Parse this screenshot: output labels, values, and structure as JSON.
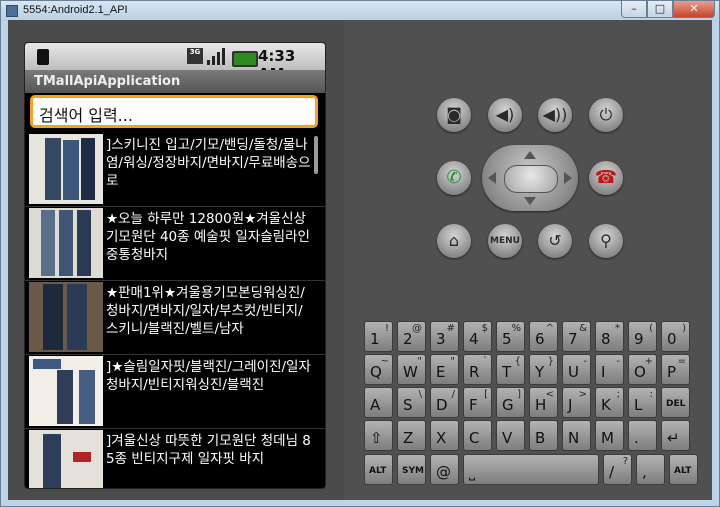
{
  "window": {
    "title": "5554:Android2.1_API",
    "minimize": "–",
    "maximize": "□",
    "close": "✕"
  },
  "statusbar": {
    "time": "4:33 AM",
    "network": "3G"
  },
  "app": {
    "title": "TMallApiApplication",
    "search_placeholder": "검색어 입력..."
  },
  "list": {
    "items": [
      {
        "text": "]스키니진 입고/기모/밴딩/돌청/물나염/워싱/정장바지/면바지/무료배송으로"
      },
      {
        "text": "★오늘 하루만 12800원★겨울신상 기모원단 40종 예술핏 일자슬림라인 중통청바지"
      },
      {
        "text": "★판매1위★겨울용기모본딩워싱진/청바지/면바지/일자/부츠컷/빈티지/스키니/블랙진/벨트/남자"
      },
      {
        "text": "]★슬림일자핏/블랙진/그레이진/일자청바지/빈티지워싱진/블랙진"
      },
      {
        "text": "]겨울신상 따뜻한 기모원단 청데님 85종 빈티지구제 일자핏 바지"
      }
    ]
  },
  "controls": {
    "camera": "camera-icon",
    "vol_down": "volume-down-icon",
    "vol_up": "volume-up-icon",
    "power": "power-icon",
    "call": "call-icon",
    "end_call": "end-call-icon",
    "home": "home-icon",
    "menu": "MENU",
    "back": "back-icon",
    "search": "search-icon"
  },
  "keyboard": {
    "row1": [
      [
        "1",
        "!"
      ],
      [
        "2",
        "@"
      ],
      [
        "3",
        "#"
      ],
      [
        "4",
        "$"
      ],
      [
        "5",
        "%"
      ],
      [
        "6",
        "^"
      ],
      [
        "7",
        "&"
      ],
      [
        "8",
        "*"
      ],
      [
        "9",
        "("
      ],
      [
        "0",
        ")"
      ]
    ],
    "row2": [
      [
        "Q",
        "~"
      ],
      [
        "W",
        "\""
      ],
      [
        "E",
        "\""
      ],
      [
        "R",
        "`"
      ],
      [
        "T",
        "{"
      ],
      [
        "Y",
        "}"
      ],
      [
        "U",
        "-"
      ],
      [
        "I",
        "-"
      ],
      [
        "O",
        "+"
      ],
      [
        "P",
        "="
      ]
    ],
    "row3": [
      [
        "A",
        ""
      ],
      [
        "S",
        "\\"
      ],
      [
        "D",
        "/"
      ],
      [
        "F",
        "["
      ],
      [
        "G",
        "]"
      ],
      [
        "H",
        "<"
      ],
      [
        "J",
        ">"
      ],
      [
        "K",
        ";"
      ],
      [
        "L",
        ":"
      ],
      [
        "DEL",
        ""
      ]
    ],
    "row4": [
      [
        "⇧",
        ""
      ],
      [
        "Z",
        ""
      ],
      [
        "X",
        ""
      ],
      [
        "C",
        ""
      ],
      [
        "V",
        ""
      ],
      [
        "B",
        ""
      ],
      [
        "N",
        ""
      ],
      [
        "M",
        ""
      ],
      [
        ".",
        ""
      ],
      [
        "↵",
        ""
      ]
    ],
    "row5": [
      [
        "ALT",
        ""
      ],
      [
        "SYM",
        ""
      ],
      [
        "@",
        ""
      ],
      [
        "⎵",
        ""
      ],
      [
        "/",
        "?"
      ],
      [
        ",",
        ""
      ],
      [
        "ALT",
        ""
      ]
    ]
  },
  "colors": {
    "search_border": "#f7a21b",
    "call": "#1f8a2c",
    "end_call": "#c11515"
  }
}
